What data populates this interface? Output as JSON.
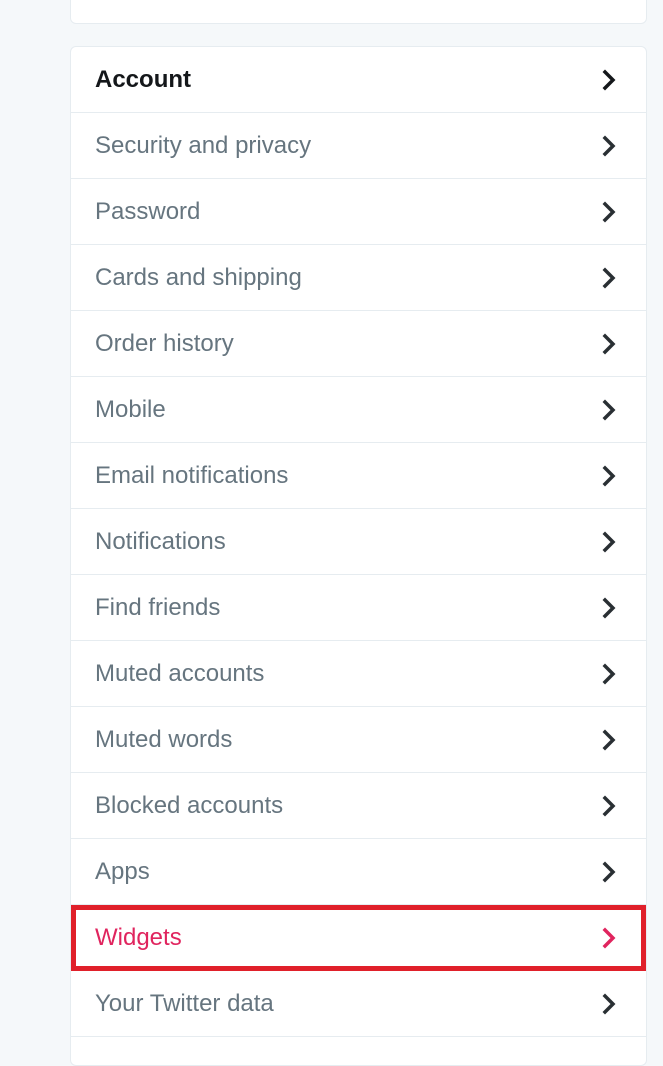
{
  "menu": {
    "items": [
      {
        "label": "Account",
        "active": true
      },
      {
        "label": "Security and privacy"
      },
      {
        "label": "Password"
      },
      {
        "label": "Cards and shipping"
      },
      {
        "label": "Order history"
      },
      {
        "label": "Mobile"
      },
      {
        "label": "Email notifications"
      },
      {
        "label": "Notifications"
      },
      {
        "label": "Find friends"
      },
      {
        "label": "Muted accounts"
      },
      {
        "label": "Muted words"
      },
      {
        "label": "Blocked accounts"
      },
      {
        "label": "Apps"
      },
      {
        "label": "Widgets",
        "highlighted": true
      },
      {
        "label": "Your Twitter data"
      }
    ],
    "icon": "chevron-right-icon"
  },
  "colors": {
    "background": "#f5f8fa",
    "card": "#ffffff",
    "border": "#e6ecf0",
    "text_muted": "#66757f",
    "text_active": "#14171a",
    "highlight_outline": "#e0202a",
    "highlight_text": "#e0245e"
  }
}
